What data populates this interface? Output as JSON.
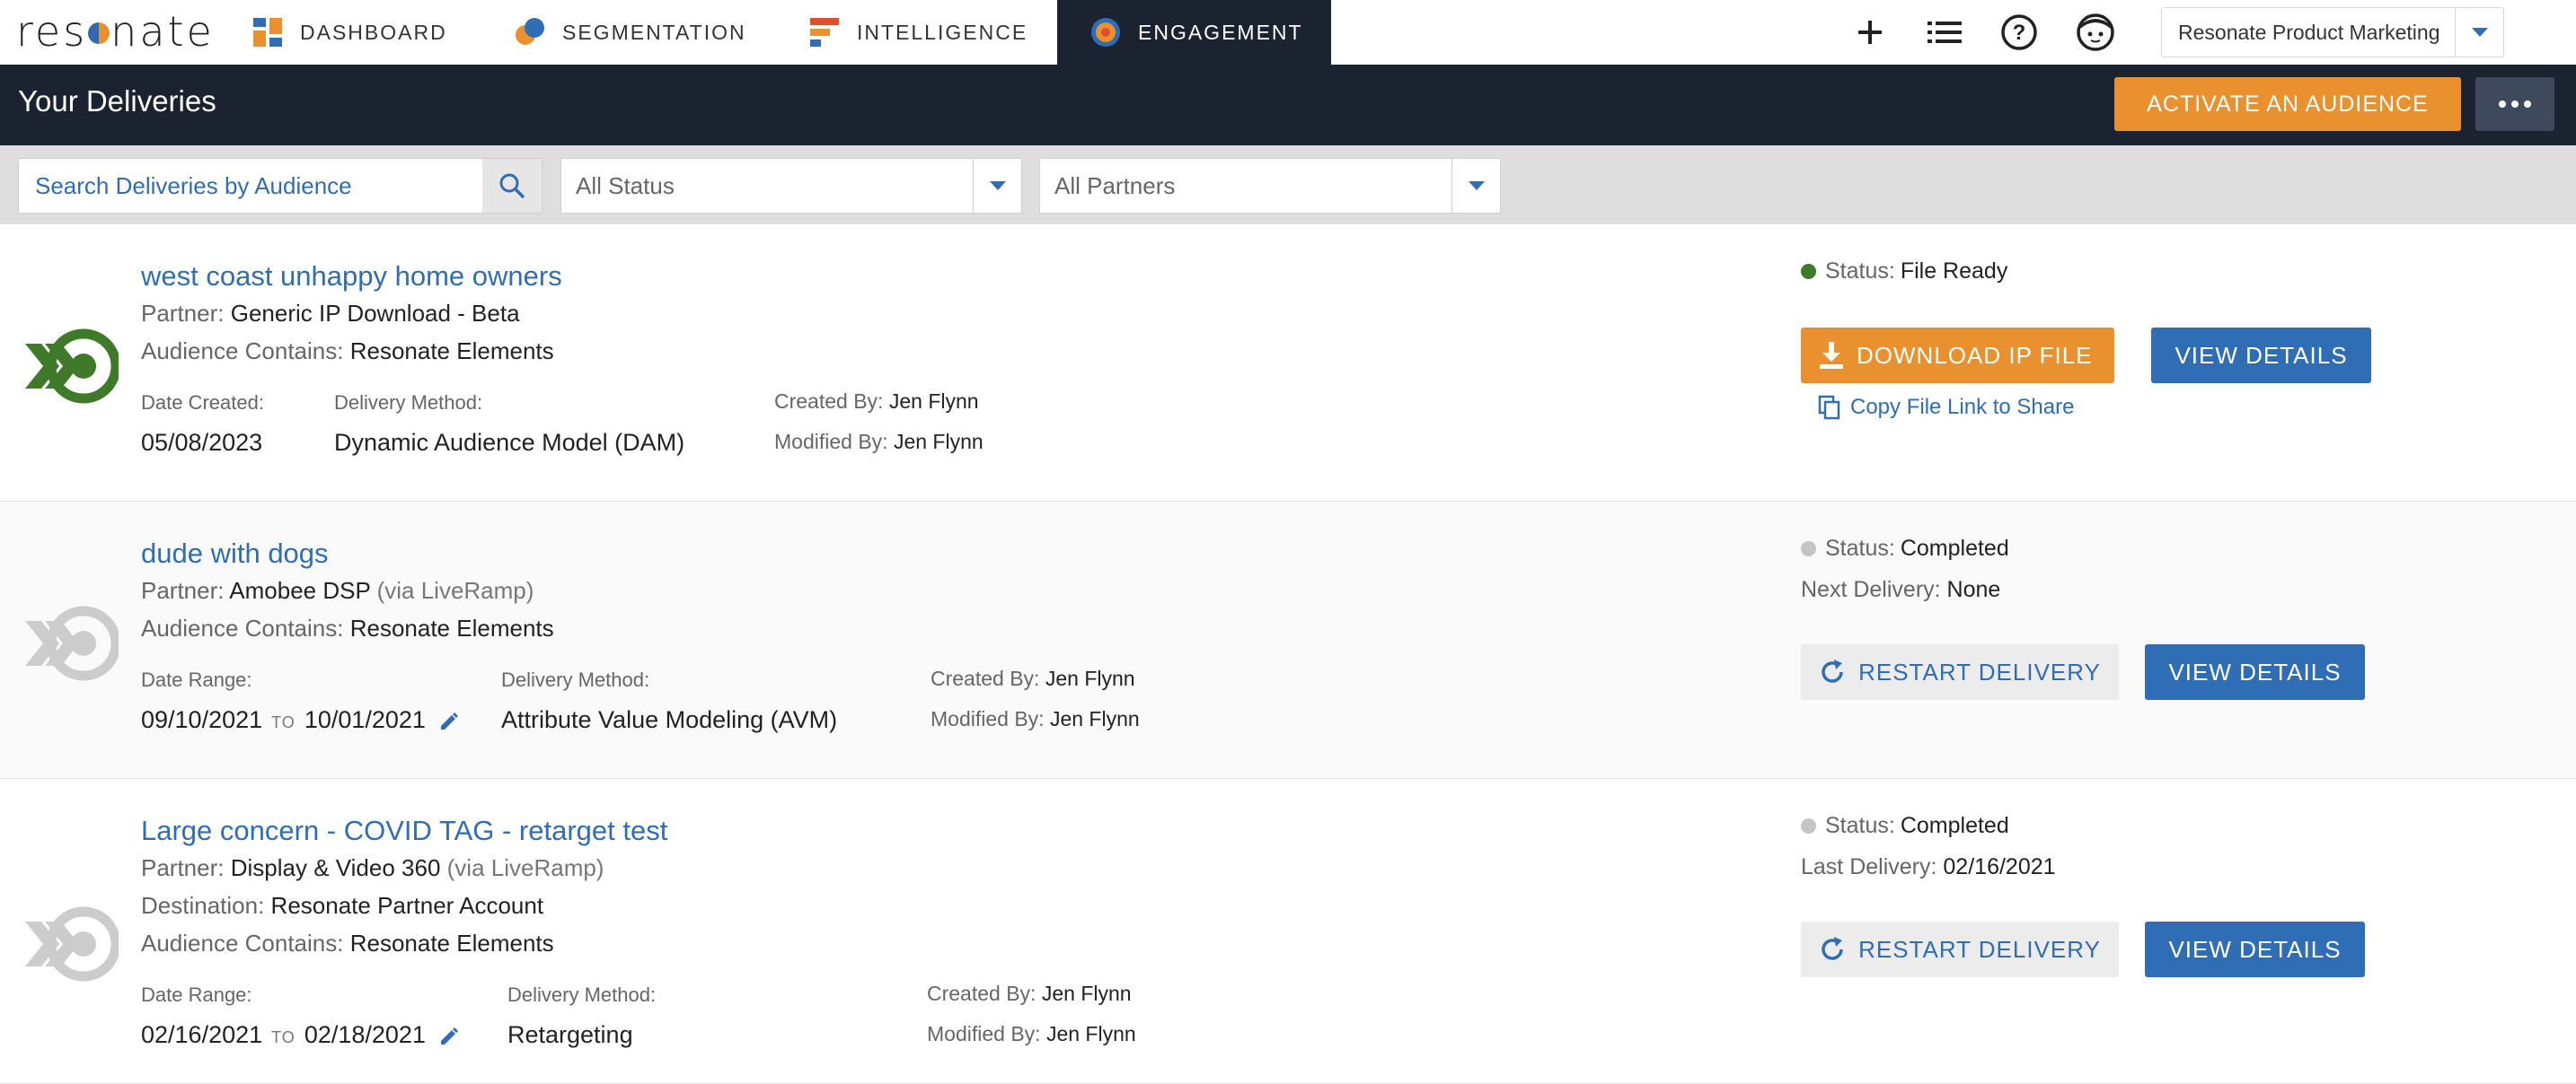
{
  "app": {
    "logo_text": "resonate"
  },
  "nav": {
    "dashboard": "DASHBOARD",
    "segmentation": "SEGMENTATION",
    "intelligence": "INTELLIGENCE",
    "engagement": "ENGAGEMENT",
    "active_tab": "engagement"
  },
  "top_icons": [
    "plus-icon",
    "list-icon",
    "help-icon",
    "user-avatar-icon"
  ],
  "org_select": {
    "value": "Resonate Product Marketing"
  },
  "header": {
    "title": "Your Deliveries",
    "activate_label": "ACTIVATE AN AUDIENCE"
  },
  "filters": {
    "search_placeholder": "Search Deliveries by Audience",
    "status_value": "All Status",
    "partner_value": "All Partners"
  },
  "labels": {
    "partner": "Partner:",
    "audience_contains": "Audience Contains:",
    "destination": "Destination:",
    "date_created": "Date Created:",
    "date_range": "Date Range:",
    "delivery_method": "Delivery Method:",
    "created_by": "Created By:",
    "modified_by": "Modified By:",
    "status": "Status",
    "next_delivery": "Next Delivery:",
    "last_delivery": "Last Delivery:",
    "to": "TO",
    "download_ip_file": "DOWNLOAD IP FILE",
    "view_details": "VIEW DETAILS",
    "restart_delivery": "RESTART DELIVERY",
    "copy_link": "Copy File Link to Share"
  },
  "deliveries": [
    {
      "name": "west coast unhappy home owners",
      "partner": "Generic IP Download - Beta",
      "partner_via": "",
      "audience_contains": "Resonate Elements",
      "date_created": "05/08/2023",
      "delivery_method": "Dynamic Audience Model (DAM)",
      "created_by": "Jen Flynn",
      "modified_by": "Jen Flynn",
      "status": "File Ready",
      "status_color": "#3f7a2a",
      "icon_color": "#3f7a2a"
    },
    {
      "name": "dude with dogs",
      "partner": "Amobee DSP",
      "partner_via": "(via LiveRamp)",
      "audience_contains": "Resonate Elements",
      "date_from": "09/10/2021",
      "date_to": "10/01/2021",
      "delivery_method": "Attribute Value Modeling (AVM)",
      "created_by": "Jen Flynn",
      "modified_by": "Jen Flynn",
      "status": "Completed",
      "next_delivery": "None",
      "status_color": "#c4c4c4",
      "icon_color": "#cccccc"
    },
    {
      "name": "Large concern - COVID TAG - retarget test",
      "partner": "Display & Video 360",
      "partner_via": "(via LiveRamp)",
      "destination": "Resonate Partner Account",
      "audience_contains": "Resonate Elements",
      "date_from": "02/16/2021",
      "date_to": "02/18/2021",
      "delivery_method": "Retargeting",
      "created_by": "Jen Flynn",
      "modified_by": "Jen Flynn",
      "status": "Completed",
      "last_delivery": "02/16/2021",
      "status_color": "#c4c4c4",
      "icon_color": "#cccccc"
    }
  ],
  "colors": {
    "accent_orange": "#e8912e",
    "primary_blue": "#2f6db4",
    "header_dark": "#1c2330"
  }
}
